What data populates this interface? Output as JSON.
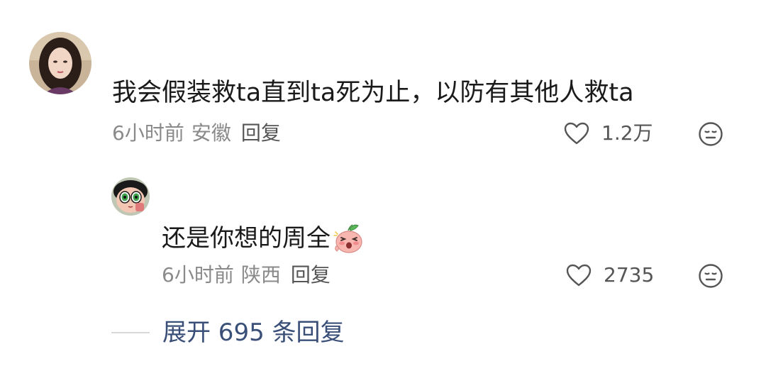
{
  "comment": {
    "text": "我会假装救ta直到ta死为止，以防有其他人救ta",
    "time": "6小时前",
    "location": "安徽",
    "reply_label": "回复",
    "likes": "1.2万"
  },
  "reply": {
    "text": "还是你想的周全",
    "emoji": "shocked-peach-emoji",
    "time": "6小时前",
    "location": "陕西",
    "reply_label": "回复",
    "likes": "2735"
  },
  "expand": {
    "label": "展开 695 条回复"
  },
  "icons": {
    "like": "heart-outline-icon",
    "dislike": "neutral-face-icon"
  },
  "colors": {
    "text": "#1a1a1a",
    "meta": "#8a8a8a",
    "link": "#3a4f78"
  }
}
